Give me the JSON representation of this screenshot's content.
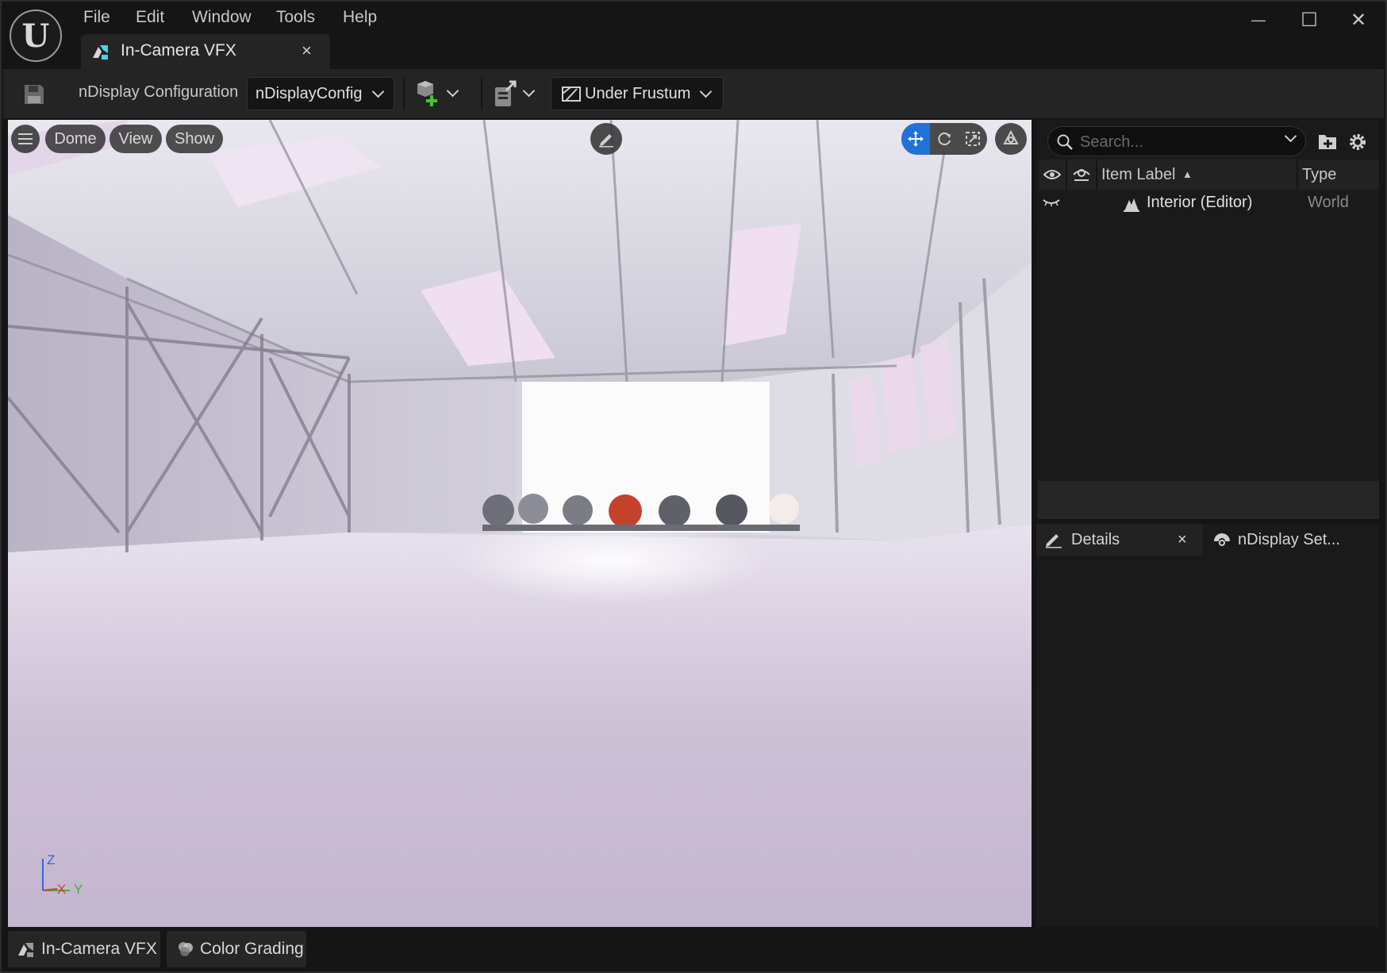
{
  "menu": [
    "File",
    "Edit",
    "Window",
    "Tools",
    "Help"
  ],
  "document_tab": {
    "label": "In-Camera VFX",
    "close": "×"
  },
  "window_controls": {
    "minimize": "—",
    "maximize": "☐",
    "close": "✕"
  },
  "toolbar": {
    "config_label": "nDisplay Configuration",
    "config_value": "nDisplayConfig",
    "frustum_value": "Under Frustum"
  },
  "viewport": {
    "menu_buttons": [
      "Dome",
      "View",
      "Show"
    ],
    "axis": {
      "z": "Z",
      "x": "X",
      "y": "Y"
    }
  },
  "outliner": {
    "search_placeholder": "Search...",
    "columns": {
      "label": "Item Label",
      "sort": "▲",
      "type": "Type"
    },
    "rows": [
      {
        "label": "Interior (Editor)",
        "type": "World"
      }
    ]
  },
  "details_tabs": [
    {
      "label": "Details",
      "close": "×"
    },
    {
      "label": "nDisplay Set..."
    }
  ],
  "bottom_tabs": [
    "In-Camera VFX",
    "Color Grading"
  ],
  "colors": {
    "accent": "#1f72d8",
    "tab_icon": "#4fd1e0"
  }
}
